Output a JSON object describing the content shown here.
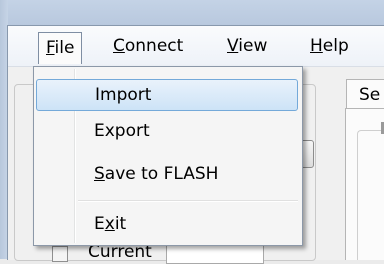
{
  "menubar": {
    "items": [
      {
        "label": "File"
      },
      {
        "label": "Connect"
      },
      {
        "label": "View"
      },
      {
        "label": "Help"
      }
    ]
  },
  "file_menu": {
    "items": [
      {
        "label": "Import",
        "highlighted": true
      },
      {
        "label": "Export"
      },
      {
        "label": "Save to FLASH"
      },
      {
        "label": "Exit"
      }
    ]
  },
  "background": {
    "tab_label": "Se",
    "partial_label": "Current"
  }
}
